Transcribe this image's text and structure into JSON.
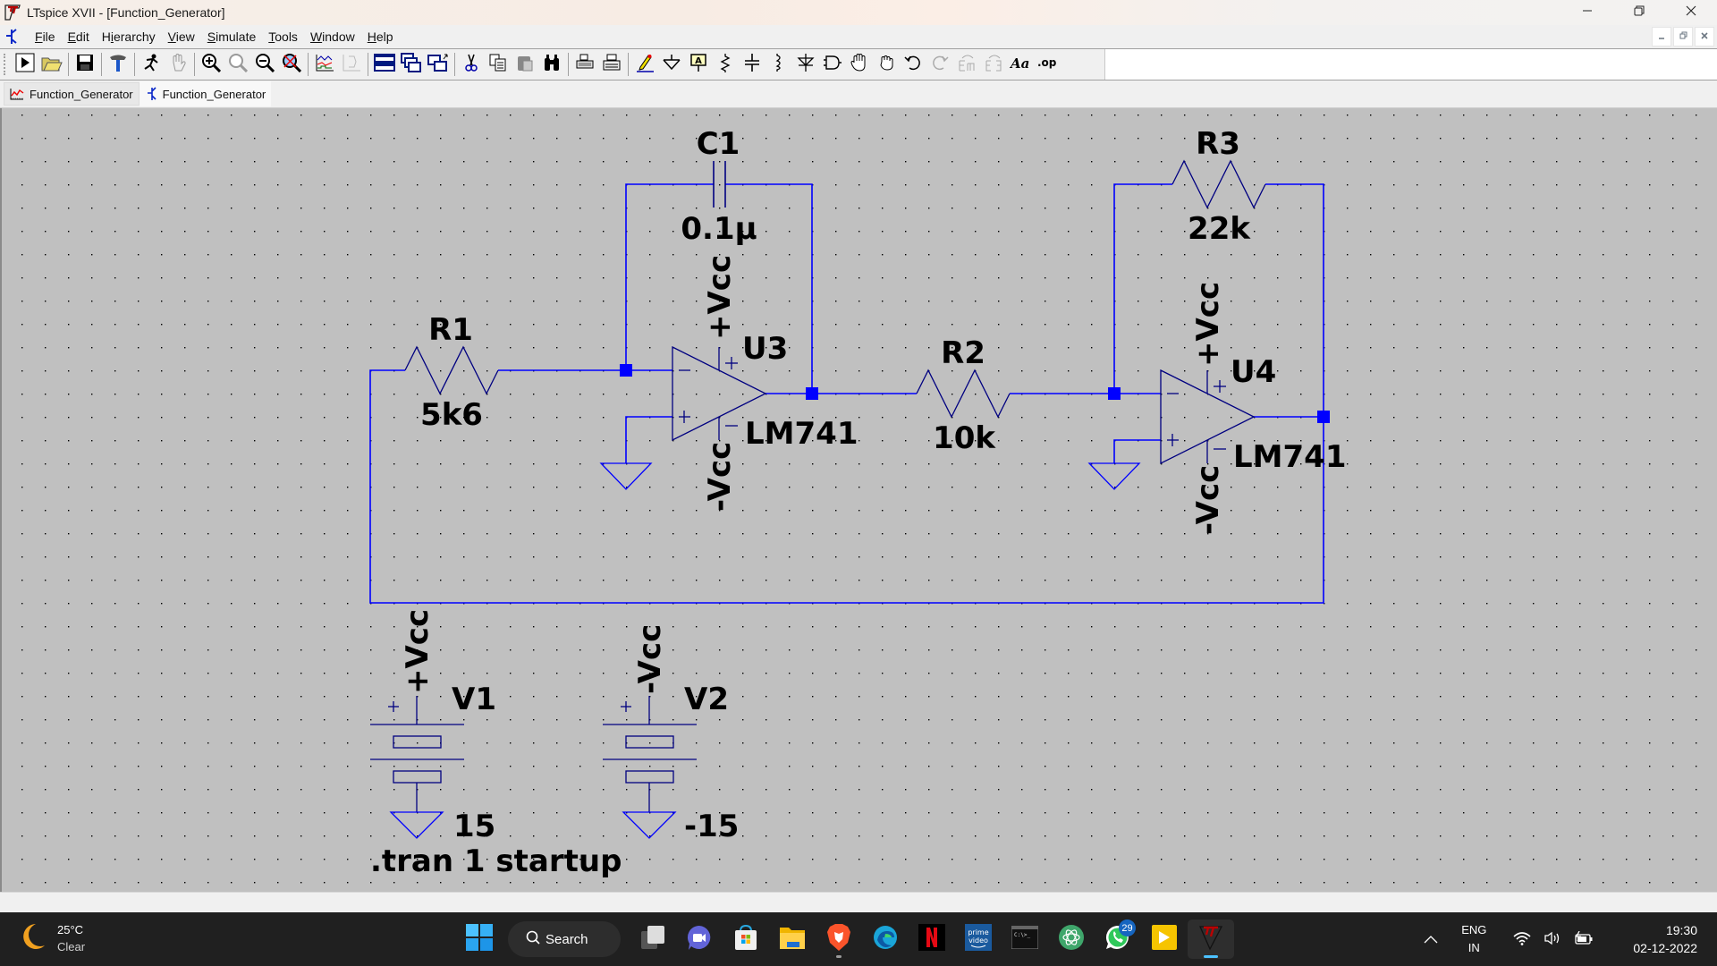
{
  "window": {
    "title": "LTspice XVII - [Function_Generator]",
    "controls": {
      "minimize": "—",
      "restore": "❐",
      "close": "✕"
    }
  },
  "menu": {
    "items": [
      {
        "label": "File",
        "accel": "F",
        "rest": "ile"
      },
      {
        "label": "Edit",
        "accel": "E",
        "rest": "dit"
      },
      {
        "label": "Hierarchy",
        "accel": "H",
        "pre": "H",
        "mid": "i",
        "rest": "erarchy"
      },
      {
        "label": "View",
        "accel": "V",
        "rest": "iew"
      },
      {
        "label": "Simulate",
        "accel": "S",
        "rest": "imulate"
      },
      {
        "label": "Tools",
        "accel": "T",
        "rest": "ools"
      },
      {
        "label": "Window",
        "accel": "W",
        "rest": "indow"
      },
      {
        "label": "Help",
        "accel": "H",
        "rest": "elp"
      }
    ],
    "mdi_controls": {
      "minimize": "_",
      "restore": "🗗",
      "close": "✕"
    }
  },
  "toolbar": {
    "buttons": [
      "run-icon",
      "open-icon",
      "save-icon",
      "control-panel-icon",
      "halt-icon",
      "pan-icon",
      "zoom-in-icon",
      "zoom-fit-icon",
      "zoom-out-icon",
      "zoom-cancel-icon",
      "plot-waveform-icon",
      "autorange-icon",
      "tile-horizontal-icon",
      "cascade-icon",
      "tile-vertical-icon",
      "cut-icon",
      "copy-icon",
      "paste-icon",
      "find-icon",
      "print-preview-icon",
      "print-icon",
      "draw-wire-icon",
      "ground-icon",
      "label-net-icon",
      "resistor-icon",
      "capacitor-icon",
      "inductor-icon",
      "diode-icon",
      "component-icon",
      "move-icon",
      "drag-icon",
      "undo-icon",
      "redo-icon",
      "rotate-icon",
      "mirror-icon",
      "text-icon",
      "spice-directive-icon"
    ]
  },
  "tabs": [
    {
      "label": "Function_Generator",
      "type": "waveform",
      "active": false
    },
    {
      "label": "Function_Generator",
      "type": "schematic",
      "active": true
    }
  ],
  "schematic": {
    "wire_color": "#0000ff",
    "components": {
      "R1": {
        "name": "R1",
        "value": "5k6"
      },
      "R2": {
        "name": "R2",
        "value": "10k"
      },
      "R3": {
        "name": "R3",
        "value": "22k"
      },
      "C1": {
        "name": "C1",
        "value": "0.1µ"
      },
      "U3": {
        "name": "U3",
        "model": "LM741",
        "pos_supply": "+Vcc",
        "neg_supply": "-Vcc"
      },
      "U4": {
        "name": "U4",
        "model": "LM741",
        "pos_supply": "+Vcc",
        "neg_supply": "-Vcc"
      },
      "V1": {
        "name": "V1",
        "value": "15",
        "net": "+Vcc"
      },
      "V2": {
        "name": "V2",
        "value": "-15",
        "net": "-Vcc"
      }
    },
    "directive": ".tran 1 startup"
  },
  "taskbar": {
    "weather": {
      "temp": "25°C",
      "condition": "Clear"
    },
    "search_label": "Search",
    "apps": [
      {
        "name": "task-view",
        "badge": null
      },
      {
        "name": "teams-meet",
        "badge": null
      },
      {
        "name": "microsoft-store",
        "badge": null
      },
      {
        "name": "file-explorer",
        "badge": null
      },
      {
        "name": "brave-browser",
        "badge": null,
        "running": true
      },
      {
        "name": "edge-browser",
        "badge": null
      },
      {
        "name": "netflix",
        "badge": null
      },
      {
        "name": "prime-video",
        "badge": null
      },
      {
        "name": "terminal",
        "badge": null
      },
      {
        "name": "atom-editor",
        "badge": null
      },
      {
        "name": "whatsapp",
        "badge": "29"
      },
      {
        "name": "video-editor",
        "badge": null
      },
      {
        "name": "ltspice",
        "badge": null,
        "active": true
      }
    ],
    "prime_text": "prime video",
    "tray": {
      "language": "ENG",
      "region": "IN",
      "time": "19:30",
      "date": "02-12-2022"
    }
  }
}
